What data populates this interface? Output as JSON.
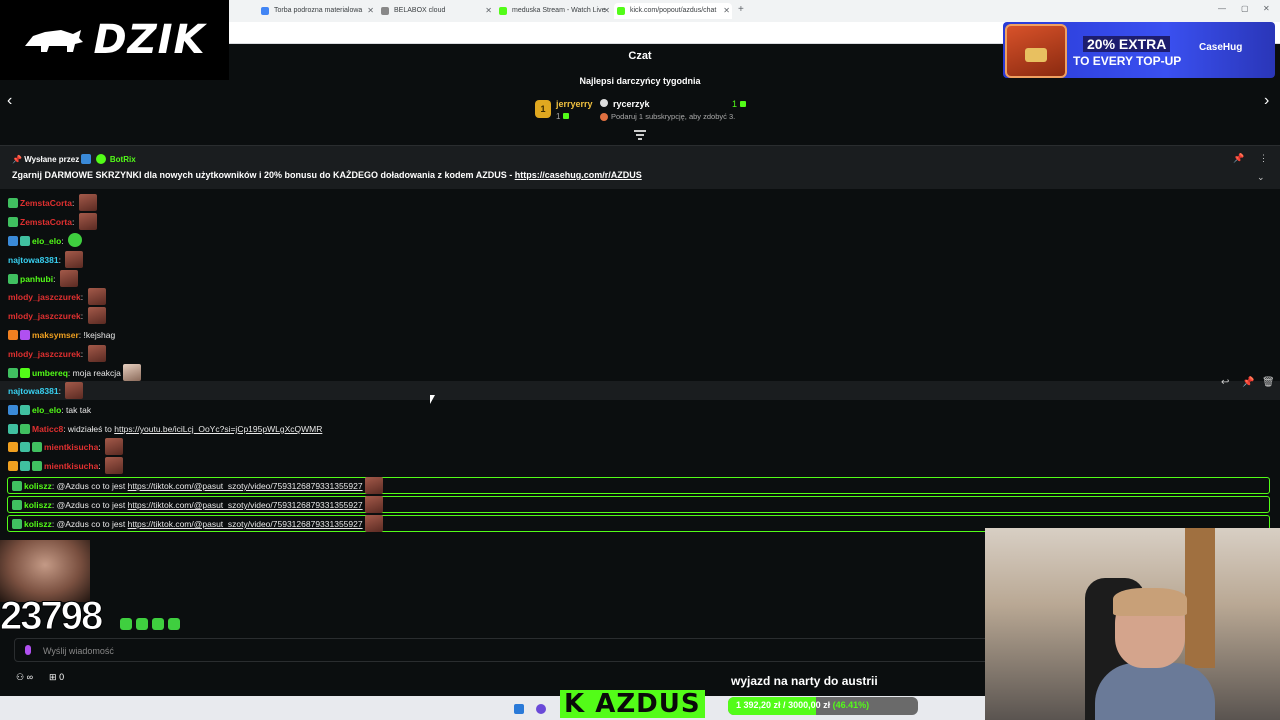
{
  "browser": {
    "tabs": [
      {
        "label": "Torba podrozna materialowa",
        "fav_color": "#4285f4"
      },
      {
        "label": "BELABOX cloud",
        "fav_color": "#888888"
      },
      {
        "label": "meduska Stream - Watch Live",
        "fav_color": "#53fc18"
      },
      {
        "label": "kick.com/popout/azdus/chat",
        "fav_color": "#53fc18"
      }
    ]
  },
  "overlay": {
    "logo_text": "DZIK"
  },
  "ad": {
    "line1": "20% EXTRA",
    "line2": "TO EVERY TOP-UP",
    "brand": "CaseHug"
  },
  "chat": {
    "title": "Czat",
    "top_gifters_title": "Najlepsi darczyńcy tygodnia",
    "gifter1": {
      "rank": "1",
      "name": "jerryerry",
      "count": "1"
    },
    "gifter2": {
      "name": "rycerzyk",
      "count": "1"
    },
    "gifter_hint": "Podaruj 1 subskrypcję, aby zdobyć 3.",
    "pinned": {
      "by_label": "Wysłane przez",
      "by_user": "BotRix",
      "text": "Zgarnij DARMOWE SKRZYNKI dla nowych użytkowników i 20% bonusu do KAŻDEGO doładowania z kodem AZDUS - ",
      "link": "https://casehug.com/r/AZDUS"
    },
    "messages": [
      {
        "user": "ZemstaCorta",
        "color": "#e03030",
        "text": "",
        "link": "",
        "emote": "red"
      },
      {
        "user": "ZemstaCorta",
        "color": "#e03030",
        "text": "",
        "link": "",
        "emote": "red"
      },
      {
        "user": "elo_elo",
        "color": "#53fc18",
        "text": "",
        "link": "",
        "emote": "green"
      },
      {
        "user": "najtowa8381",
        "color": "#38d0f0",
        "text": "",
        "link": "",
        "emote": "red"
      },
      {
        "user": "panhubi",
        "color": "#53fc18",
        "text": "",
        "link": "",
        "emote": "red"
      },
      {
        "user": "mlody_jaszczurek",
        "color": "#e03030",
        "text": "",
        "link": "",
        "emote": "red"
      },
      {
        "user": "mlody_jaszczurek",
        "color": "#e03030",
        "text": "",
        "link": "",
        "emote": "red"
      },
      {
        "user": "maksymser",
        "color": "#f0a020",
        "text": "!kejshag",
        "link": "",
        "emote": ""
      },
      {
        "user": "mlody_jaszczurek",
        "color": "#e03030",
        "text": "",
        "link": "",
        "emote": "red"
      },
      {
        "user": "umbereq",
        "color": "#53fc18",
        "text": "moja reakcja",
        "link": "",
        "emote": "face"
      },
      {
        "user": "najtowa8381",
        "color": "#38d0f0",
        "text": "",
        "link": "",
        "emote": "red"
      },
      {
        "user": "elo_elo",
        "color": "#53fc18",
        "text": "tak tak",
        "link": "",
        "emote": ""
      },
      {
        "user": "Maticc8",
        "color": "#e03030",
        "text": "widziałeś to ",
        "link": "https://youtu.be/iciLcj_OoYc?si=jCp195pWLgXcQWMR",
        "emote": ""
      },
      {
        "user": "mientkisucha",
        "color": "#e03030",
        "text": "",
        "link": "",
        "emote": "red"
      },
      {
        "user": "mientkisucha",
        "color": "#e03030",
        "text": "",
        "link": "",
        "emote": "red"
      },
      {
        "user": "koliszz",
        "color": "#53fc18",
        "text": "@Azdus co to jest ",
        "link": "https://tiktok.com/@pasut_szoty/video/7593126879331355927",
        "emote": "red"
      },
      {
        "user": "koliszz",
        "color": "#53fc18",
        "text": "@Azdus co to jest ",
        "link": "https://tiktok.com/@pasut_szoty/video/7593126879331355927",
        "emote": "red"
      },
      {
        "user": "koliszz",
        "color": "#53fc18",
        "text": "@Azdus co to jest ",
        "link": "https://tiktok.com/@pasut_szoty/video/7593126879331355927",
        "emote": "red"
      }
    ],
    "input_placeholder": "Wyślij wiadomość",
    "viewer_count_label": "∞",
    "gift_count": "0"
  },
  "stream_overlay": {
    "big_counter": "23798",
    "goal_title": "wyjazd na narty do austrii",
    "kick_label": "K AZDUS",
    "goal_current": "1 392,20 zł",
    "goal_sep": " / ",
    "goal_target": "3000,00 zł",
    "goal_percent": "(46.41%)",
    "goal_fraction": 0.4641
  },
  "colors": {
    "accent": "#53fc18",
    "bg": "#0b0e0f"
  }
}
